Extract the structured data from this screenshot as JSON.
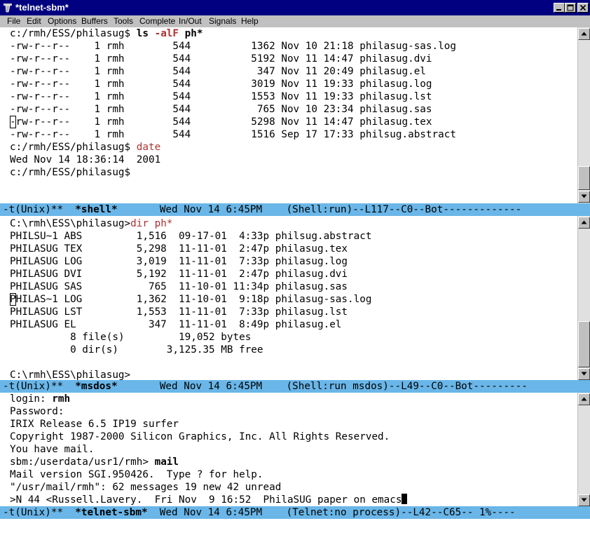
{
  "window": {
    "title": "*telnet-sbm*"
  },
  "menu": [
    "File",
    "Edit",
    "Options",
    "Buffers",
    "Tools",
    "Complete",
    "In/Out",
    "Signals",
    "Help"
  ],
  "shell_pane": {
    "prompt1": "c:/rmh/ESS/philasug$ ",
    "cmd1_a": "ls ",
    "cmd1_b": "-alF",
    "cmd1_c": " ph*",
    "listing": [
      {
        "perm": "-rw-r--r--",
        "links": "1",
        "owner": "rmh",
        "group": "544",
        "size": "1362",
        "date": "Nov 10 21:18",
        "name": "philasug-sas.log"
      },
      {
        "perm": "-rw-r--r--",
        "links": "1",
        "owner": "rmh",
        "group": "544",
        "size": "5192",
        "date": "Nov 11 14:47",
        "name": "philasug.dvi"
      },
      {
        "perm": "-rw-r--r--",
        "links": "1",
        "owner": "rmh",
        "group": "544",
        "size": "347",
        "date": "Nov 11 20:49",
        "name": "philasug.el"
      },
      {
        "perm": "-rw-r--r--",
        "links": "1",
        "owner": "rmh",
        "group": "544",
        "size": "3019",
        "date": "Nov 11 19:33",
        "name": "philasug.log"
      },
      {
        "perm": "-rw-r--r--",
        "links": "1",
        "owner": "rmh",
        "group": "544",
        "size": "1553",
        "date": "Nov 11 19:33",
        "name": "philasug.lst"
      },
      {
        "perm": "-rw-r--r--",
        "links": "1",
        "owner": "rmh",
        "group": "544",
        "size": "765",
        "date": "Nov 10 23:34",
        "name": "philasug.sas"
      },
      {
        "perm": "-rw-r--r--",
        "links": "1",
        "owner": "rmh",
        "group": "544",
        "size": "5298",
        "date": "Nov 11 14:47",
        "name": "philasug.tex"
      },
      {
        "perm": "-rw-r--r--",
        "links": "1",
        "owner": "rmh",
        "group": "544",
        "size": "1516",
        "date": "Sep 17 17:33",
        "name": "philsug.abstract"
      }
    ],
    "prompt2": "c:/rmh/ESS/philasug$ ",
    "cmd2": "date",
    "date_output": "Wed Nov 14 18:36:14  2001",
    "prompt3": "c:/rmh/ESS/philasug$"
  },
  "modeline_shell": {
    "prefix": "-t(Unix)**  ",
    "buffer": "*shell*",
    "rest": "       Wed Nov 14 6:45PM    (Shell:run)--L117--C0--Bot-------------"
  },
  "msdos_pane": {
    "prompt1": "C:\\rmh\\ESS\\philasug>",
    "cmd1": "dir ph*",
    "listing": [
      {
        "short": "PHILSU~1",
        "ext": "ABS",
        "size": "1,516",
        "date": "09-17-01",
        "time": "4:33p",
        "long": "philsug.abstract"
      },
      {
        "short": "PHILASUG",
        "ext": "TEX",
        "size": "5,298",
        "date": "11-11-01",
        "time": "2:47p",
        "long": "philasug.tex"
      },
      {
        "short": "PHILASUG",
        "ext": "LOG",
        "size": "3,019",
        "date": "11-11-01",
        "time": "7:33p",
        "long": "philasug.log"
      },
      {
        "short": "PHILASUG",
        "ext": "DVI",
        "size": "5,192",
        "date": "11-11-01",
        "time": "2:47p",
        "long": "philasug.dvi"
      },
      {
        "short": "PHILASUG",
        "ext": "SAS",
        "size": "765",
        "date": "11-10-01",
        "time": "11:34p",
        "long": "philasug.sas"
      },
      {
        "short": "PHILAS~1",
        "ext": "LOG",
        "size": "1,362",
        "date": "11-10-01",
        "time": "9:18p",
        "long": "philasug-sas.log"
      },
      {
        "short": "PHILASUG",
        "ext": "LST",
        "size": "1,553",
        "date": "11-11-01",
        "time": "7:33p",
        "long": "philasug.lst"
      },
      {
        "short": "PHILASUG",
        "ext": "EL",
        "size": "347",
        "date": "11-11-01",
        "time": "8:49p",
        "long": "philasug.el"
      }
    ],
    "files_line": "8 file(s)         19,052 bytes",
    "dirs_line": "0 dir(s)        3,125.35 MB free",
    "prompt2": "C:\\rmh\\ESS\\philasug>"
  },
  "modeline_msdos": {
    "prefix": "-t(Unix)**  ",
    "buffer": "*msdos*",
    "rest": "       Wed Nov 14 6:45PM    (Shell:run msdos)--L49--C0--Bot---------"
  },
  "telnet_pane": {
    "login_label": "login: ",
    "login_value": "rmh",
    "password_label": "Password:",
    "line_irix": "IRIX Release 6.5 IP19 surfer",
    "line_copyright": "Copyright 1987-2000 Silicon Graphics, Inc. All Rights Reserved.",
    "line_mail": "You have mail.",
    "prompt": "sbm:/userdata/usr1/rmh> ",
    "cmd": "mail",
    "line_version": "Mail version SGI.950426.  Type ? for help.",
    "line_status": "\"/usr/mail/rmh\": 62 messages 19 new 42 unread",
    "line_message": ">N 44 <Russell.Lavery.  Fri Nov  9 16:52  PhilaSUG paper on emacs"
  },
  "modeline_telnet": {
    "prefix": "-t(Unix)**  ",
    "buffer": "*telnet-sbm*",
    "rest": "  Wed Nov 14 6:45PM    (Telnet:no process)--L42--C65-- 1%----"
  },
  "colors": {
    "titlebar": "#000080",
    "modeline": "#6ab6e8",
    "command_red": "#b03030",
    "chrome": "#c0c0c0"
  }
}
